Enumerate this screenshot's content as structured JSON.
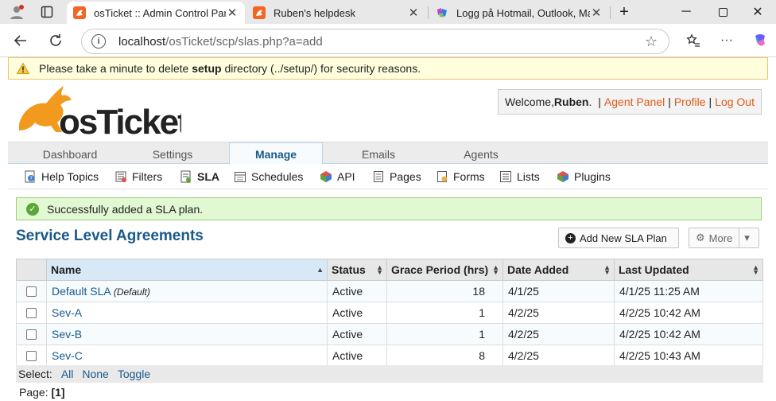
{
  "browser": {
    "tabs": [
      {
        "title": "osTicket :: Admin Control Panel",
        "active": true
      },
      {
        "title": "Ruben's helpdesk",
        "active": false
      },
      {
        "title": "Logg på Hotmail, Outlook, Mai",
        "active": false
      }
    ],
    "new_tab": "+",
    "url_host": "localhost",
    "url_path": "/osTicket/scp/slas.php?a=add"
  },
  "warning": {
    "prefix": "Please take a minute to delete ",
    "bold": "setup",
    "suffix": " directory (../setup/) for security reasons."
  },
  "header": {
    "logo_text": "osTicket",
    "welcome_prefix": "Welcome, ",
    "user": "Ruben",
    "welcome_suffix": ".",
    "links": [
      "Agent Panel",
      "Profile",
      "Log Out"
    ]
  },
  "main_nav": [
    "Dashboard",
    "Settings",
    "Manage",
    "Emails",
    "Agents"
  ],
  "sub_nav": [
    "Help Topics",
    "Filters",
    "SLA",
    "Schedules",
    "API",
    "Pages",
    "Forms",
    "Lists",
    "Plugins"
  ],
  "notice": "Successfully added a SLA plan.",
  "page_title": "Service Level Agreements",
  "buttons": {
    "add": "Add New SLA Plan",
    "more": "More"
  },
  "table": {
    "headers": [
      "Name",
      "Status",
      "Grace Period (hrs)",
      "Date Added",
      "Last Updated"
    ],
    "rows": [
      {
        "name": "Default SLA",
        "tag": "(Default)",
        "status": "Active",
        "grace": "18",
        "added": "4/1/25",
        "updated": "4/1/25 11:25 AM"
      },
      {
        "name": "Sev-A",
        "tag": "",
        "status": "Active",
        "grace": "1",
        "added": "4/2/25",
        "updated": "4/2/25 10:42 AM"
      },
      {
        "name": "Sev-B",
        "tag": "",
        "status": "Active",
        "grace": "1",
        "added": "4/2/25",
        "updated": "4/2/25 10:42 AM"
      },
      {
        "name": "Sev-C",
        "tag": "",
        "status": "Active",
        "grace": "8",
        "added": "4/2/25",
        "updated": "4/2/25 10:43 AM"
      }
    ]
  },
  "select": {
    "label": "Select:",
    "options": [
      "All",
      "None",
      "Toggle"
    ]
  },
  "pager": {
    "label": "Page:",
    "current": "[1]"
  },
  "colors": {
    "link": "#1a5a8a",
    "accent": "#e05a16",
    "success_bg": "#e1f8d2",
    "warn_bg": "#ffffdd"
  }
}
